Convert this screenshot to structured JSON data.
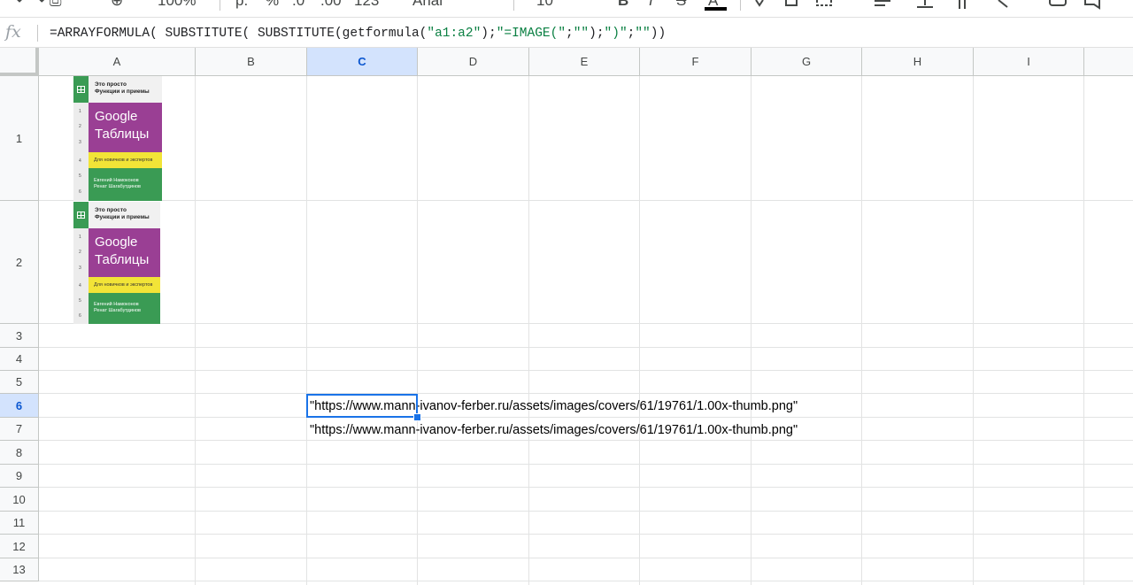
{
  "toolbar": {
    "undo_group": "↶ ↷ ⎙",
    "paint_format": "⊕",
    "zoom": "100%",
    "currency": "р.",
    "percent": "%",
    "decimal_dec": ".0",
    "decimal_inc": ".00",
    "more_formats": "123",
    "font_name": "Arial",
    "font_size": "10",
    "bold": "B",
    "italic": "I",
    "strike": "S",
    "text_color": "A"
  },
  "formula_bar": {
    "fx": "fx",
    "formula_parts": [
      {
        "t": "=ARRAYFORMULA( SUBSTITUTE( SUBSTITUTE(getformula(",
        "c": "plain"
      },
      {
        "t": "\"a1:a2\"",
        "c": "str"
      },
      {
        "t": ");",
        "c": "plain"
      },
      {
        "t": "\"=IMAGE(\"",
        "c": "str"
      },
      {
        "t": ";",
        "c": "plain"
      },
      {
        "t": "\"\"",
        "c": "str"
      },
      {
        "t": ");",
        "c": "plain"
      },
      {
        "t": "\")\"",
        "c": "str"
      },
      {
        "t": ";",
        "c": "plain"
      },
      {
        "t": "\"\"",
        "c": "str"
      },
      {
        "t": "))",
        "c": "plain"
      }
    ]
  },
  "columns": [
    "A",
    "B",
    "C",
    "D",
    "E",
    "F",
    "G",
    "H",
    "I"
  ],
  "rows": [
    "1",
    "2",
    "3",
    "4",
    "5",
    "6",
    "7",
    "8",
    "9",
    "10",
    "11",
    "12",
    "13"
  ],
  "selected_column": "C",
  "selected_row": "6",
  "cells": {
    "C6": "\"https://www.mann-ivanov-ferber.ru/assets/images/covers/61/19761/1.00x-thumb.png\"",
    "C7": "\"https://www.mann-ivanov-ferber.ru/assets/images/covers/61/19761/1.00x-thumb.png\""
  },
  "book_cover": {
    "subtitle_line1": "Это просто",
    "subtitle_line2": "Функции и приемы",
    "title_line1": "Google",
    "title_line2": "Таблицы",
    "tagline": "Для новичков и экспертов",
    "author1": "Евгений Намоконов",
    "author2": "Ренат Шагабутдинов",
    "row_numbers": [
      "1",
      "2",
      "3",
      "4",
      "5",
      "6"
    ],
    "colors": {
      "purple": "#9a3f94",
      "green": "#3a9b54",
      "yellow": "#f2e437"
    }
  },
  "colors": {
    "selection": "#1a73e8",
    "header_bg": "#f8f9fa",
    "selected_header_bg": "#d3e3fd",
    "string_literal": "#0b8043"
  }
}
